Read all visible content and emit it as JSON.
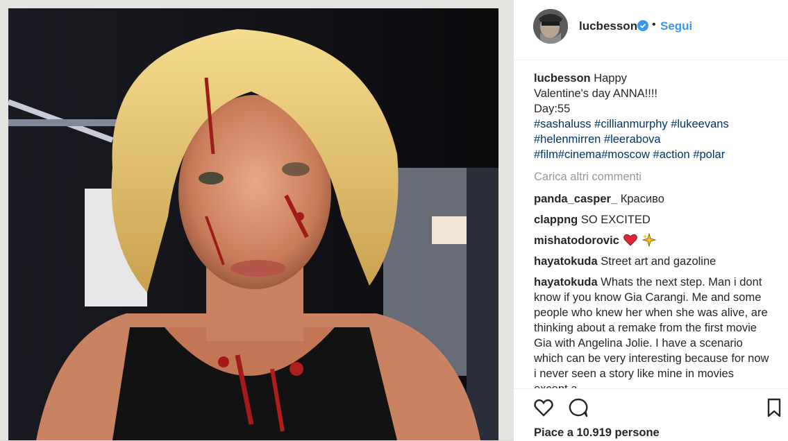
{
  "post": {
    "username": "lucbesson",
    "separator": "•",
    "follow_label": "Segui",
    "caption": {
      "username": "lucbesson",
      "line1": "Happy",
      "line2": "Valentine's day ANNA!!!!",
      "line3": "Day:55",
      "hashtags_line1": [
        "#sashaluss",
        "#cillianmurphy",
        "#lukeevans"
      ],
      "hashtags_line2": [
        "#helenmirren",
        "#leerabova"
      ],
      "hashtags_line3": [
        "#film",
        "#cinema",
        "#moscow",
        "#action",
        "#polar"
      ]
    },
    "load_more_label": "Carica altri commenti",
    "comments": [
      {
        "user": "panda_casper_",
        "text": "Красиво"
      },
      {
        "user": "clappng",
        "text": "SO EXCITED"
      },
      {
        "user": "mishatodorovic",
        "text": ""
      },
      {
        "user": "hayatokuda",
        "text": "Street art and gazoline"
      },
      {
        "user": "hayatokuda",
        "text": "Whats the next step. Man i dont know if you know Gia Carangi. Me and some people who knew her when she was alive, are thinking about a remake from the first movie Gia with Angelina Jolie. I have a scenario which can be very interesting because for now i never seen a story like mine in movies except a"
      }
    ],
    "likes_label": "Piace a 10.919 persone"
  },
  "icons": {
    "avatar": "avatar-photo",
    "verified": "verified-badge-icon",
    "like": "heart-outline-icon",
    "comment": "comment-bubble-icon",
    "save": "bookmark-icon",
    "emoji_heart": "red-heart-emoji",
    "emoji_sparkles": "sparkles-emoji"
  },
  "colors": {
    "link_blue": "#3897f0",
    "hashtag": "#003569",
    "muted": "#999999",
    "text": "#262626"
  }
}
